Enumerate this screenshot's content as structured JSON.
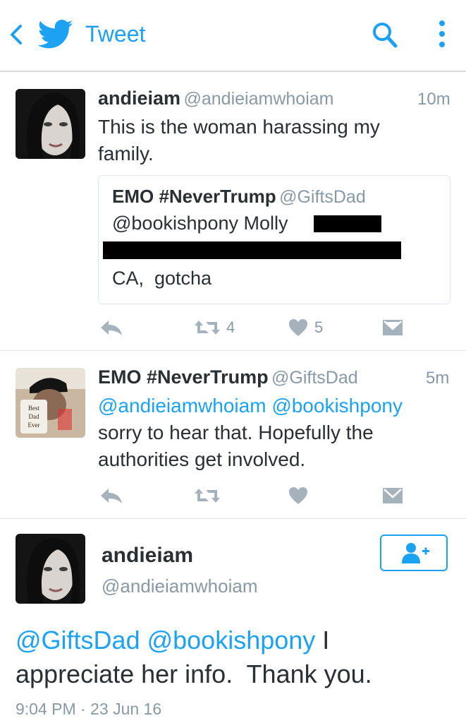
{
  "header": {
    "title": "Tweet"
  },
  "tweets": [
    {
      "name": "andieiam",
      "handle": "@andieiamwhoiam",
      "time": "10m",
      "text_lines": [
        "This is the woman harassing my",
        "family."
      ],
      "quote": {
        "name": "EMO #NeverTrump",
        "handle": "@GiftsDad",
        "line1": "@bookishpony Molly",
        "line3": "CA,  gotcha"
      },
      "retweets": "4",
      "likes": "5"
    },
    {
      "name": "EMO #NeverTrump",
      "handle": "@GiftsDad",
      "time": "5m",
      "mentions": "@andieiamwhoiam @bookishpony",
      "text_lines": [
        "sorry to hear that. Hopefully the",
        "authorities get involved."
      ],
      "avatar_mug_text": "Best Dad Ever"
    }
  ],
  "reply": {
    "name": "andieiam",
    "handle": "@andieiamwhoiam",
    "mentions": "@GiftsDad @bookishpony",
    "text_after_mentions": " I",
    "text_line2": "appreciate her info.  Thank you.",
    "timestamp": "9:04 PM · 23 Jun 16"
  },
  "colors": {
    "accent": "#1da1f2",
    "muted": "#8899a6",
    "icon": "#a5b1bb"
  }
}
